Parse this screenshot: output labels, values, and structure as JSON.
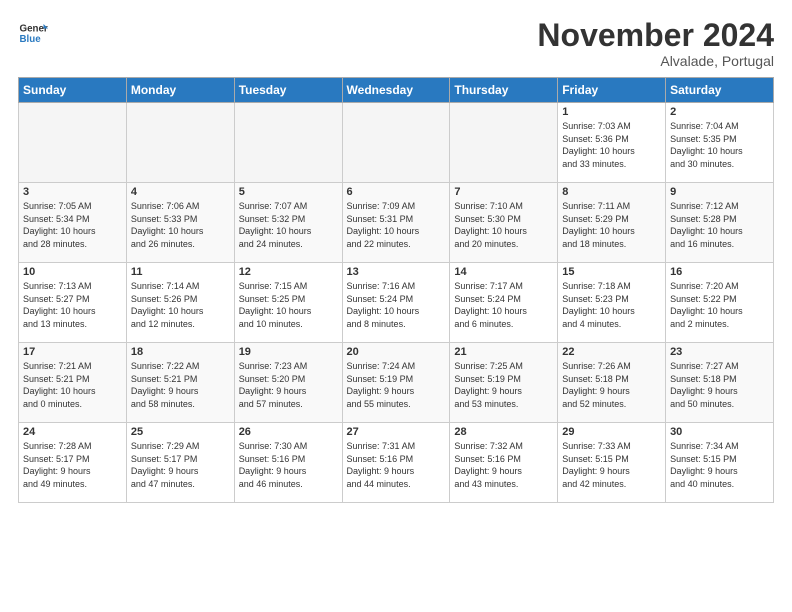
{
  "logo": {
    "line1": "General",
    "line2": "Blue"
  },
  "title": "November 2024",
  "location": "Alvalade, Portugal",
  "weekdays": [
    "Sunday",
    "Monday",
    "Tuesday",
    "Wednesday",
    "Thursday",
    "Friday",
    "Saturday"
  ],
  "weeks": [
    [
      {
        "day": "",
        "info": ""
      },
      {
        "day": "",
        "info": ""
      },
      {
        "day": "",
        "info": ""
      },
      {
        "day": "",
        "info": ""
      },
      {
        "day": "",
        "info": ""
      },
      {
        "day": "1",
        "info": "Sunrise: 7:03 AM\nSunset: 5:36 PM\nDaylight: 10 hours\nand 33 minutes."
      },
      {
        "day": "2",
        "info": "Sunrise: 7:04 AM\nSunset: 5:35 PM\nDaylight: 10 hours\nand 30 minutes."
      }
    ],
    [
      {
        "day": "3",
        "info": "Sunrise: 7:05 AM\nSunset: 5:34 PM\nDaylight: 10 hours\nand 28 minutes."
      },
      {
        "day": "4",
        "info": "Sunrise: 7:06 AM\nSunset: 5:33 PM\nDaylight: 10 hours\nand 26 minutes."
      },
      {
        "day": "5",
        "info": "Sunrise: 7:07 AM\nSunset: 5:32 PM\nDaylight: 10 hours\nand 24 minutes."
      },
      {
        "day": "6",
        "info": "Sunrise: 7:09 AM\nSunset: 5:31 PM\nDaylight: 10 hours\nand 22 minutes."
      },
      {
        "day": "7",
        "info": "Sunrise: 7:10 AM\nSunset: 5:30 PM\nDaylight: 10 hours\nand 20 minutes."
      },
      {
        "day": "8",
        "info": "Sunrise: 7:11 AM\nSunset: 5:29 PM\nDaylight: 10 hours\nand 18 minutes."
      },
      {
        "day": "9",
        "info": "Sunrise: 7:12 AM\nSunset: 5:28 PM\nDaylight: 10 hours\nand 16 minutes."
      }
    ],
    [
      {
        "day": "10",
        "info": "Sunrise: 7:13 AM\nSunset: 5:27 PM\nDaylight: 10 hours\nand 13 minutes."
      },
      {
        "day": "11",
        "info": "Sunrise: 7:14 AM\nSunset: 5:26 PM\nDaylight: 10 hours\nand 12 minutes."
      },
      {
        "day": "12",
        "info": "Sunrise: 7:15 AM\nSunset: 5:25 PM\nDaylight: 10 hours\nand 10 minutes."
      },
      {
        "day": "13",
        "info": "Sunrise: 7:16 AM\nSunset: 5:24 PM\nDaylight: 10 hours\nand 8 minutes."
      },
      {
        "day": "14",
        "info": "Sunrise: 7:17 AM\nSunset: 5:24 PM\nDaylight: 10 hours\nand 6 minutes."
      },
      {
        "day": "15",
        "info": "Sunrise: 7:18 AM\nSunset: 5:23 PM\nDaylight: 10 hours\nand 4 minutes."
      },
      {
        "day": "16",
        "info": "Sunrise: 7:20 AM\nSunset: 5:22 PM\nDaylight: 10 hours\nand 2 minutes."
      }
    ],
    [
      {
        "day": "17",
        "info": "Sunrise: 7:21 AM\nSunset: 5:21 PM\nDaylight: 10 hours\nand 0 minutes."
      },
      {
        "day": "18",
        "info": "Sunrise: 7:22 AM\nSunset: 5:21 PM\nDaylight: 9 hours\nand 58 minutes."
      },
      {
        "day": "19",
        "info": "Sunrise: 7:23 AM\nSunset: 5:20 PM\nDaylight: 9 hours\nand 57 minutes."
      },
      {
        "day": "20",
        "info": "Sunrise: 7:24 AM\nSunset: 5:19 PM\nDaylight: 9 hours\nand 55 minutes."
      },
      {
        "day": "21",
        "info": "Sunrise: 7:25 AM\nSunset: 5:19 PM\nDaylight: 9 hours\nand 53 minutes."
      },
      {
        "day": "22",
        "info": "Sunrise: 7:26 AM\nSunset: 5:18 PM\nDaylight: 9 hours\nand 52 minutes."
      },
      {
        "day": "23",
        "info": "Sunrise: 7:27 AM\nSunset: 5:18 PM\nDaylight: 9 hours\nand 50 minutes."
      }
    ],
    [
      {
        "day": "24",
        "info": "Sunrise: 7:28 AM\nSunset: 5:17 PM\nDaylight: 9 hours\nand 49 minutes."
      },
      {
        "day": "25",
        "info": "Sunrise: 7:29 AM\nSunset: 5:17 PM\nDaylight: 9 hours\nand 47 minutes."
      },
      {
        "day": "26",
        "info": "Sunrise: 7:30 AM\nSunset: 5:16 PM\nDaylight: 9 hours\nand 46 minutes."
      },
      {
        "day": "27",
        "info": "Sunrise: 7:31 AM\nSunset: 5:16 PM\nDaylight: 9 hours\nand 44 minutes."
      },
      {
        "day": "28",
        "info": "Sunrise: 7:32 AM\nSunset: 5:16 PM\nDaylight: 9 hours\nand 43 minutes."
      },
      {
        "day": "29",
        "info": "Sunrise: 7:33 AM\nSunset: 5:15 PM\nDaylight: 9 hours\nand 42 minutes."
      },
      {
        "day": "30",
        "info": "Sunrise: 7:34 AM\nSunset: 5:15 PM\nDaylight: 9 hours\nand 40 minutes."
      }
    ]
  ]
}
